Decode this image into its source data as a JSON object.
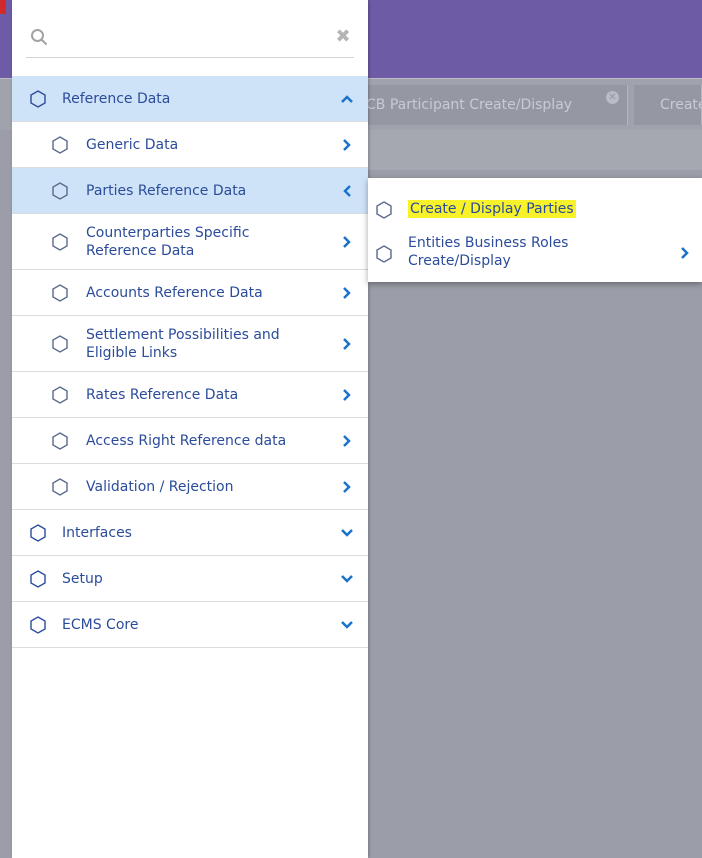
{
  "colors": {
    "header": "#6e5ba6",
    "menu_text": "#2b4c9a",
    "active_bg": "#cfe3f8",
    "chevron": "#1a73c9",
    "highlight": "#f7f22a"
  },
  "tabs": [
    {
      "label": "CB Participant Create/Display"
    },
    {
      "label": "Create"
    }
  ],
  "search": {
    "placeholder": "",
    "value": ""
  },
  "menu": {
    "items": [
      {
        "label": "Reference Data",
        "icon": "hexagon-icon",
        "state": "expanded"
      },
      {
        "label": "Generic Data",
        "icon": "hexagon-icon"
      },
      {
        "label": "Parties Reference Data",
        "icon": "hexagon-icon",
        "state": "open"
      },
      {
        "label": "Counterparties Specific Reference Data",
        "icon": "hexagon-icon"
      },
      {
        "label": "Accounts Reference Data",
        "icon": "hexagon-icon"
      },
      {
        "label": "Settlement Possibilities and Eligible Links",
        "icon": "hexagon-icon"
      },
      {
        "label": "Rates Reference Data",
        "icon": "hexagon-icon"
      },
      {
        "label": "Access Right Reference data",
        "icon": "hexagon-icon"
      },
      {
        "label": "Validation / Rejection",
        "icon": "hexagon-icon"
      },
      {
        "label": "Interfaces",
        "icon": "hexagon-icon",
        "state": "collapsed"
      },
      {
        "label": "Setup",
        "icon": "hexagon-icon",
        "state": "collapsed"
      },
      {
        "label": "ECMS Core",
        "icon": "hexagon-icon",
        "state": "collapsed"
      }
    ]
  },
  "flyout": {
    "items": [
      {
        "label": "Create / Display Parties",
        "highlighted": true
      },
      {
        "label": "Entities Business Roles Create/Display"
      }
    ]
  }
}
